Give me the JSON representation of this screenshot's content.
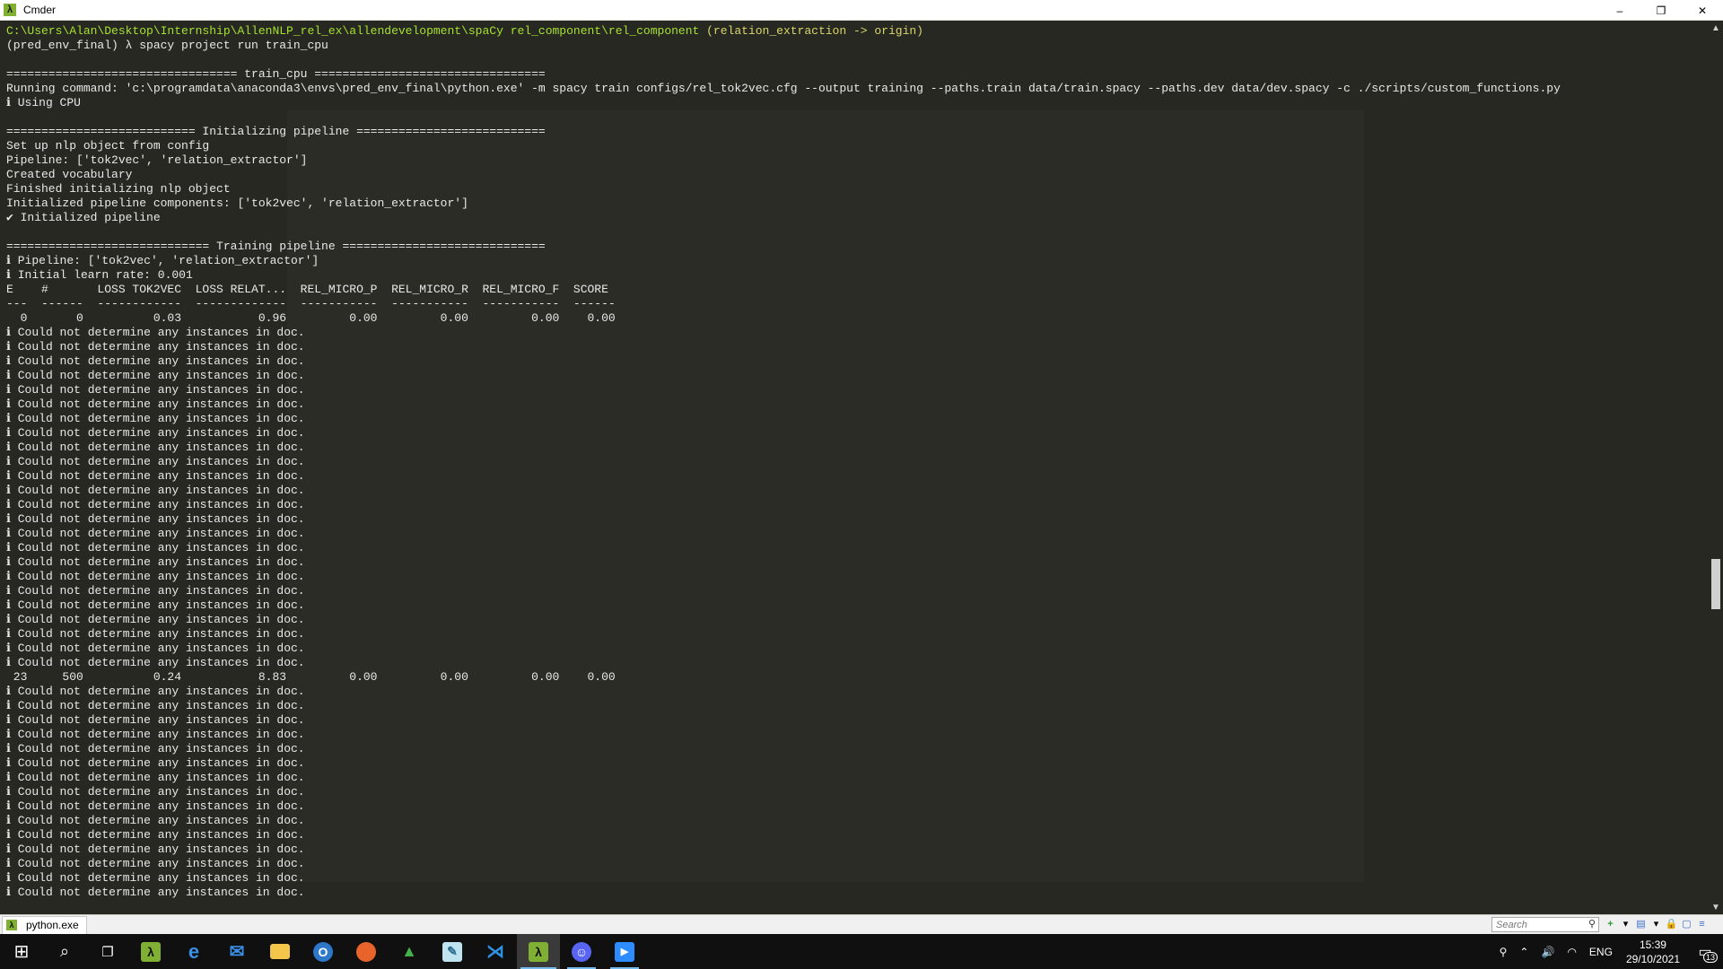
{
  "window": {
    "title": "Cmder",
    "minimize": "–",
    "restore": "❐",
    "close": "✕"
  },
  "terminal": {
    "lines": [
      {
        "text": "C:\\Users\\Alan\\Desktop\\Internship\\AllenNLP_rel_ex\\allendevelopment\\spaCy rel_component\\rel_component",
        "tail": " (relation_extraction -> origin)",
        "style": "prompt-path"
      },
      {
        "text": "(pred_env_final) λ spacy project run train_cpu"
      },
      {
        "text": ""
      },
      {
        "text": "================================= train_cpu ================================="
      },
      {
        "text": "Running command: 'c:\\programdata\\anaconda3\\envs\\pred_env_final\\python.exe' -m spacy train configs/rel_tok2vec.cfg --output training --paths.train data/train.spacy --paths.dev data/dev.spacy -c ./scripts/custom_functions.py"
      },
      {
        "text": "ℹ Using CPU"
      },
      {
        "text": ""
      },
      {
        "text": "=========================== Initializing pipeline ==========================="
      },
      {
        "text": "Set up nlp object from config"
      },
      {
        "text": "Pipeline: ['tok2vec', 'relation_extractor']"
      },
      {
        "text": "Created vocabulary"
      },
      {
        "text": "Finished initializing nlp object"
      },
      {
        "text": "Initialized pipeline components: ['tok2vec', 'relation_extractor']"
      },
      {
        "text": "✔ Initialized pipeline"
      },
      {
        "text": ""
      },
      {
        "text": "============================= Training pipeline ============================="
      },
      {
        "text": "ℹ Pipeline: ['tok2vec', 'relation_extractor']"
      },
      {
        "text": "ℹ Initial learn rate: 0.001"
      },
      {
        "text": "E    #       LOSS TOK2VEC  LOSS RELAT...  REL_MICRO_P  REL_MICRO_R  REL_MICRO_F  SCORE"
      },
      {
        "text": "---  ------  ------------  -------------  -----------  -----------  -----------  ------"
      },
      {
        "text": "  0       0          0.03           0.96         0.00         0.00         0.00    0.00"
      },
      {
        "text": "ℹ Could not determine any instances in doc."
      },
      {
        "text": "ℹ Could not determine any instances in doc."
      },
      {
        "text": "ℹ Could not determine any instances in doc."
      },
      {
        "text": "ℹ Could not determine any instances in doc."
      },
      {
        "text": "ℹ Could not determine any instances in doc."
      },
      {
        "text": "ℹ Could not determine any instances in doc."
      },
      {
        "text": "ℹ Could not determine any instances in doc."
      },
      {
        "text": "ℹ Could not determine any instances in doc."
      },
      {
        "text": "ℹ Could not determine any instances in doc."
      },
      {
        "text": "ℹ Could not determine any instances in doc."
      },
      {
        "text": "ℹ Could not determine any instances in doc."
      },
      {
        "text": "ℹ Could not determine any instances in doc."
      },
      {
        "text": "ℹ Could not determine any instances in doc."
      },
      {
        "text": "ℹ Could not determine any instances in doc."
      },
      {
        "text": "ℹ Could not determine any instances in doc."
      },
      {
        "text": "ℹ Could not determine any instances in doc."
      },
      {
        "text": "ℹ Could not determine any instances in doc."
      },
      {
        "text": "ℹ Could not determine any instances in doc."
      },
      {
        "text": "ℹ Could not determine any instances in doc."
      },
      {
        "text": "ℹ Could not determine any instances in doc."
      },
      {
        "text": "ℹ Could not determine any instances in doc."
      },
      {
        "text": "ℹ Could not determine any instances in doc."
      },
      {
        "text": "ℹ Could not determine any instances in doc."
      },
      {
        "text": "ℹ Could not determine any instances in doc."
      },
      {
        "text": " 23     500          0.24           8.83         0.00         0.00         0.00    0.00"
      },
      {
        "text": "ℹ Could not determine any instances in doc."
      },
      {
        "text": "ℹ Could not determine any instances in doc."
      },
      {
        "text": "ℹ Could not determine any instances in doc."
      },
      {
        "text": "ℹ Could not determine any instances in doc."
      },
      {
        "text": "ℹ Could not determine any instances in doc."
      },
      {
        "text": "ℹ Could not determine any instances in doc."
      },
      {
        "text": "ℹ Could not determine any instances in doc."
      },
      {
        "text": "ℹ Could not determine any instances in doc."
      },
      {
        "text": "ℹ Could not determine any instances in doc."
      },
      {
        "text": "ℹ Could not determine any instances in doc."
      },
      {
        "text": "ℹ Could not determine any instances in doc."
      },
      {
        "text": "ℹ Could not determine any instances in doc."
      },
      {
        "text": "ℹ Could not determine any instances in doc."
      },
      {
        "text": "ℹ Could not determine any instances in doc."
      },
      {
        "text": "ℹ Could not determine any instances in doc."
      }
    ]
  },
  "tabbar": {
    "tab_label": "python.exe",
    "search_placeholder": "Search",
    "tab_icon": "λ"
  },
  "taskbar": {
    "apps": [
      {
        "name": "start-icon",
        "glyph": "⊞"
      },
      {
        "name": "search-icon",
        "glyph": "⌕"
      },
      {
        "name": "task-view-icon",
        "glyph": "❐"
      },
      {
        "name": "cmder-app-icon",
        "glyph": "λ"
      },
      {
        "name": "edge-icon",
        "glyph": "e"
      },
      {
        "name": "mail-icon",
        "glyph": "✉"
      },
      {
        "name": "file-explorer-icon",
        "glyph": "▬"
      },
      {
        "name": "outlook-icon",
        "glyph": "O"
      },
      {
        "name": "firefox-icon",
        "glyph": "◉"
      },
      {
        "name": "anaconda-icon",
        "glyph": "▲"
      },
      {
        "name": "notes-icon",
        "glyph": "✎"
      },
      {
        "name": "vscode-icon",
        "glyph": "⋊"
      },
      {
        "name": "cmder-running-icon",
        "glyph": "λ"
      },
      {
        "name": "discord-icon",
        "glyph": "☺"
      },
      {
        "name": "zoom-icon",
        "glyph": "▶"
      }
    ],
    "tray": {
      "language": "ENG",
      "time": "15:39",
      "date": "29/10/2021",
      "notifications": "13"
    }
  },
  "colors": {
    "terminal_bg": "#272822",
    "prompt_green": "#a6e22e",
    "branch_yellow": "#d9d66a",
    "taskbar_bg": "#101010",
    "accent": "#76b9ed"
  }
}
